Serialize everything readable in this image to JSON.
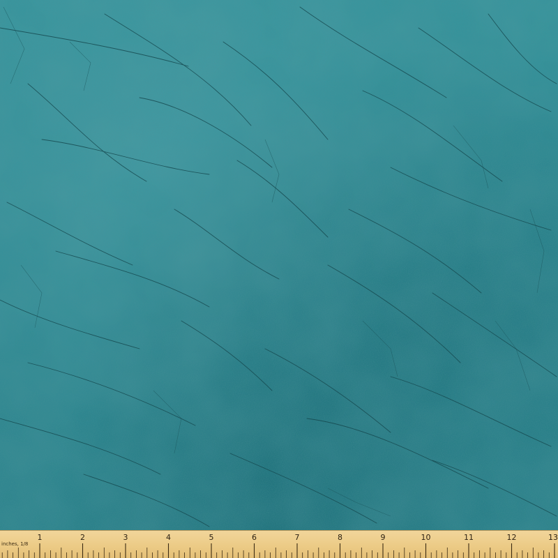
{
  "image": {
    "subject": "teal-fabric-swatch",
    "fabric_color": "#2f8a93",
    "crease_color": "#15464c"
  },
  "ruler": {
    "unit_label": "inches, 1/8",
    "numbers": [
      "1",
      "2",
      "3",
      "4",
      "5",
      "6",
      "7",
      "8",
      "9",
      "10",
      "11",
      "12",
      "13"
    ],
    "color": "#eccb86"
  }
}
